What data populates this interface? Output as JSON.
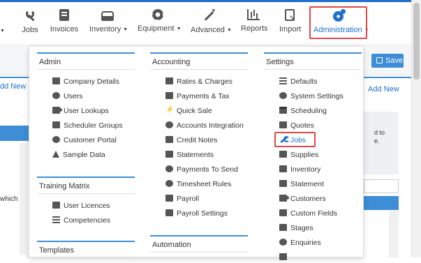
{
  "nav": {
    "items": [
      {
        "label": "Jobs",
        "icon": "wrench-icon"
      },
      {
        "label": "Invoices",
        "icon": "book-icon"
      },
      {
        "label": "Inventory",
        "icon": "tray-icon",
        "has_caret": true
      },
      {
        "label": "Equipment",
        "icon": "gear-icon",
        "has_caret": true
      },
      {
        "label": "Advanced",
        "icon": "magic-wand-icon",
        "has_caret": true
      },
      {
        "label": "Reports",
        "icon": "bar-chart-icon"
      },
      {
        "label": "Import",
        "icon": "import-icon"
      },
      {
        "label": "Administration",
        "icon": "gears-icon",
        "has_caret": true,
        "active": true
      }
    ],
    "caret": "▼"
  },
  "toolbar": {
    "save_label": "Save"
  },
  "background": {
    "add_new_left": "dd New",
    "add_new_right": "Add New",
    "left_snippet": "which",
    "right_snippet_1": "d to",
    "right_snippet_2": "e."
  },
  "menu": {
    "admin": {
      "title": "Admin",
      "items": [
        "Company Details",
        "Users",
        "User Lookups",
        "Scheduler Groups",
        "Customer Portal",
        "Sample Data"
      ]
    },
    "training": {
      "title": "Training Matrix",
      "items": [
        "User Licences",
        "Competencies"
      ]
    },
    "templates": {
      "title": "Templates"
    },
    "accounting": {
      "title": "Accounting",
      "items": [
        "Rates & Charges",
        "Payments & Tax",
        "Quick Sale",
        "Accounts Integration",
        "Credit Notes",
        "Statements",
        "Payments To Send",
        "Timesheet Rules",
        "Payroll",
        "Payroll Settings"
      ]
    },
    "automation": {
      "title": "Automation"
    },
    "settings": {
      "title": "Settings",
      "items": [
        "Defaults",
        "System Settings",
        "Scheduling",
        "Quotes",
        "Jobs",
        "Supplies",
        "Inventory",
        "Statement",
        "Customers",
        "Custom Fields",
        "Stages",
        "Enquiries"
      ]
    }
  },
  "colors": {
    "accent": "#1f6fce",
    "highlight_border": "#e04848",
    "button_blue": "#3d8ed6"
  }
}
